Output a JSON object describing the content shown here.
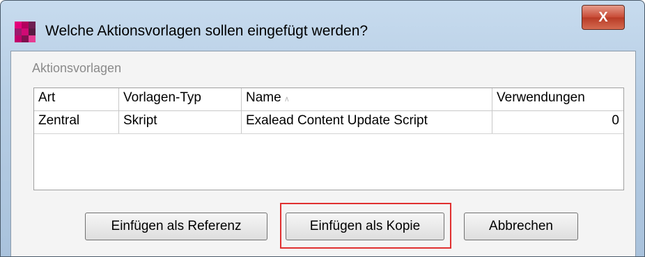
{
  "window": {
    "title": "Welche Aktionsvorlagen sollen eingefügt werden?",
    "close_glyph": "X",
    "icon": "app-icon",
    "icon_colors": [
      "#e3007b",
      "#b3005d",
      "#6f1f52",
      "#9c1a6c",
      "#d10a75",
      "#5a1a42",
      "#c0006a",
      "#80104f",
      "#e63c93"
    ]
  },
  "group": {
    "label": "Aktionsvorlagen"
  },
  "table": {
    "columns": [
      "Art",
      "Vorlagen-Typ",
      "Name",
      "Verwendungen"
    ],
    "sort_indicator": "∧",
    "rows": [
      [
        "Zentral",
        "Skript",
        "Exalead Content Update Script",
        "0"
      ]
    ]
  },
  "buttons": {
    "reference": "Einfügen als Referenz",
    "copy": "Einfügen als Kopie",
    "cancel": "Abbrechen"
  },
  "colors": {
    "highlight": "#e03030",
    "titlebar": "#b6cde4"
  }
}
